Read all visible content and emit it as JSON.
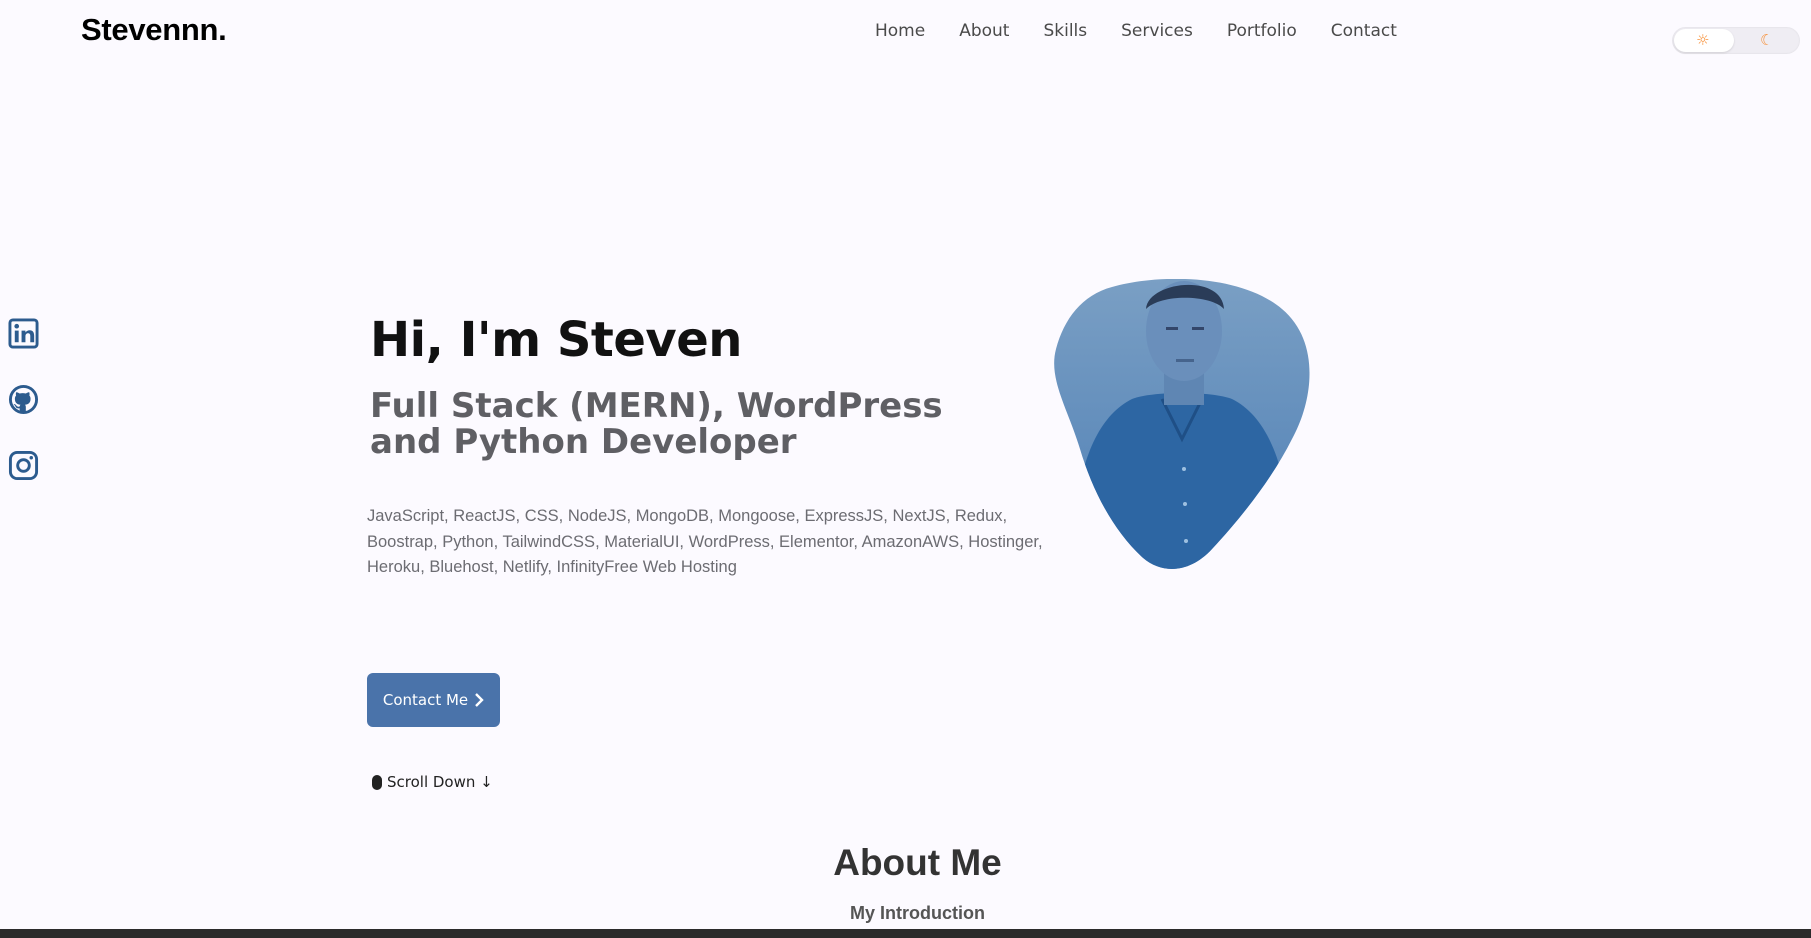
{
  "header": {
    "logo": "Stevennn.",
    "nav": [
      "Home",
      "About",
      "Skills",
      "Services",
      "Portfolio",
      "Contact"
    ],
    "theme_toggle": {
      "light_icon": "sun-icon",
      "dark_icon": "moon-icon",
      "light_glyph": "☼",
      "dark_glyph": "☾"
    }
  },
  "social": [
    "linkedin-icon",
    "github-icon",
    "instagram-icon"
  ],
  "hero": {
    "title": "Hi, I'm Steven",
    "subtitle": "Full Stack (MERN), WordPress and Python Developer",
    "description": "JavaScript, ReactJS, CSS, NodeJS, MongoDB, Mongoose, ExpressJS, NextJS, Redux, Boostrap, Python, TailwindCSS, MaterialUI, WordPress, Elementor, AmazonAWS, Hostinger, Heroku, Bluehost, Netlify, InfinityFree Web Hosting",
    "contact_button": "Contact Me",
    "scroll_down": "Scroll Down ↓"
  },
  "about": {
    "title": "About Me",
    "subtitle": "My Introduction"
  },
  "colors": {
    "background": "#fcfaff",
    "accent": "#4a73aa",
    "toggle_icon": "#f7913a"
  }
}
